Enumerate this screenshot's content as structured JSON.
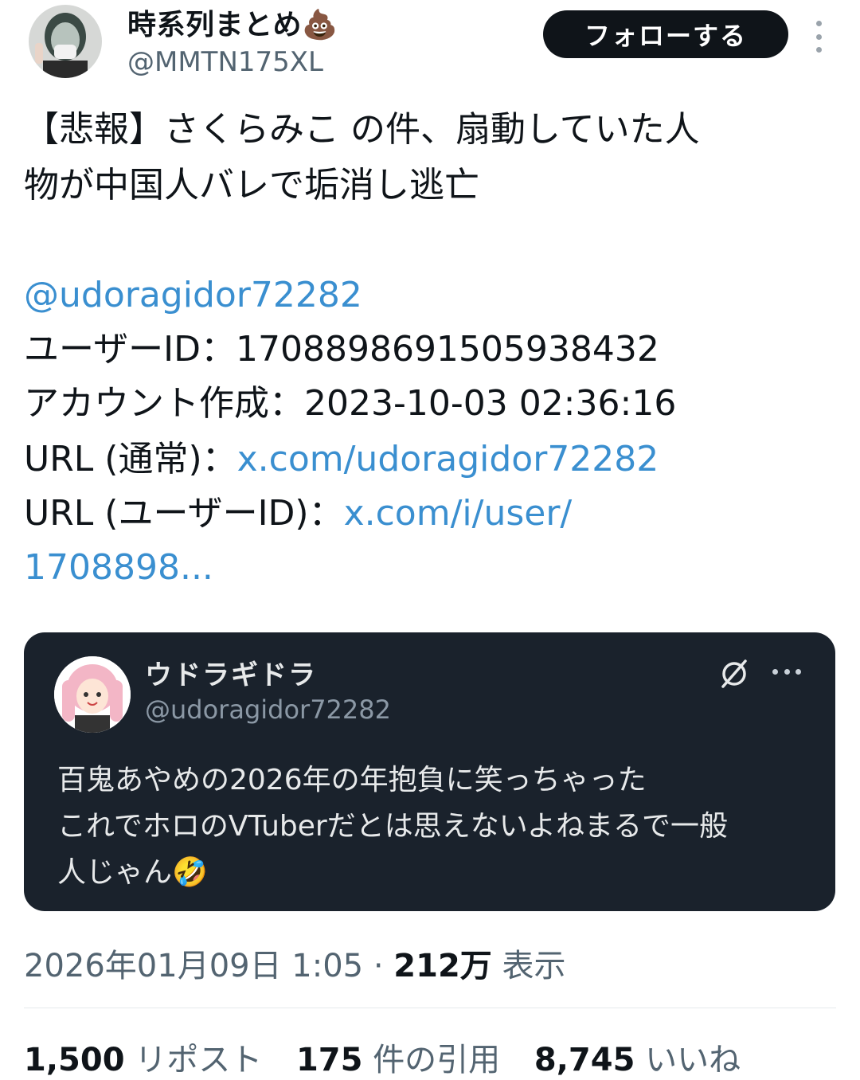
{
  "header": {
    "display_name": "時系列まとめ",
    "name_emoji": "💩",
    "handle": "@MMTN175XL",
    "follow_label": "フォローする"
  },
  "tweet": {
    "line1": "【悲報】さくらみこ の件、扇動していた人",
    "line2": "物が中国人バレで垢消し逃亡",
    "mention": "@udoragidor72282",
    "user_id_label": "ユーザーID：",
    "user_id_value": "1708898691505938432",
    "created_label": "アカウント作成：",
    "created_value": "2023-10-03 02:36:16",
    "url_normal_label": "URL (通常)：",
    "url_normal_link": "x.com/udoragidor72282",
    "url_id_label": "URL (ユーザーID)：",
    "url_id_link_1": "x.com/i/user/",
    "url_id_link_2": "1708898..."
  },
  "quote": {
    "name": "ウドラギドラ",
    "handle": "@udoragidor72282",
    "line1": "百鬼あやめの2026年の年抱負に笑っちゃった",
    "line2": "これでホロのVTuberだとは思えないよねまるで一般",
    "line3": "人じゃん",
    "emoji": "🤣"
  },
  "meta": {
    "datetime": "2026年01月09日 1:05",
    "separator": "·",
    "views_count": "212万",
    "views_label": "表示"
  },
  "stats": {
    "reposts_count": "1,500",
    "reposts_label": "リポスト",
    "quotes_count": "175",
    "quotes_label": "件の引用",
    "likes_count": "8,745",
    "likes_label": "いいね"
  },
  "colors": {
    "link": "#3a8fd0",
    "card_bg": "#1a222c",
    "muted": "#536471"
  }
}
